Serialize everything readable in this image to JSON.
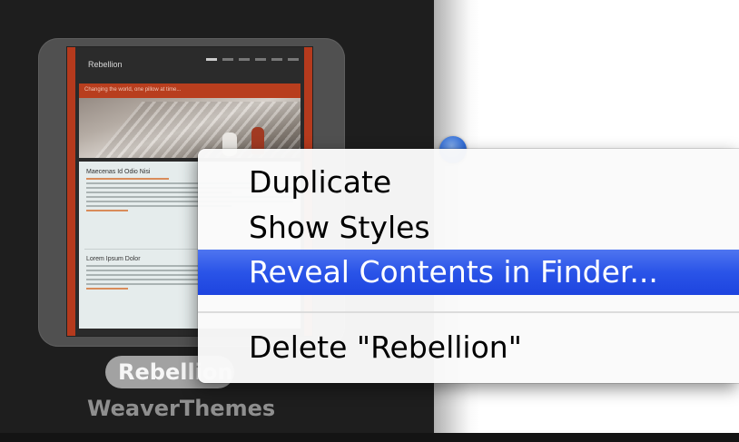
{
  "theme_browser": {
    "selected_theme": {
      "name": "Rebellion",
      "author": "WeaverThemes",
      "preview": {
        "site_title": "Rebellion",
        "banner_text": "Changing the world, one pillow at time...",
        "post_titles": [
          "Maecenas Id Odio Nisi",
          "Lorem Ipsum Dolor"
        ]
      }
    }
  },
  "context_menu": {
    "items": [
      {
        "label": "Duplicate"
      },
      {
        "label": "Show Styles"
      },
      {
        "label": "Reveal Contents in Finder..."
      },
      {
        "label": "Delete \"Rebellion\""
      }
    ],
    "highlighted_index": 2,
    "highlight_color": "#2a54e8"
  },
  "colors": {
    "panel_background": "#1e1e1e",
    "thumbnail_frame": "#505050",
    "theme_accent": "#b53a1d",
    "scroll_knob": "#2f6bd6"
  }
}
